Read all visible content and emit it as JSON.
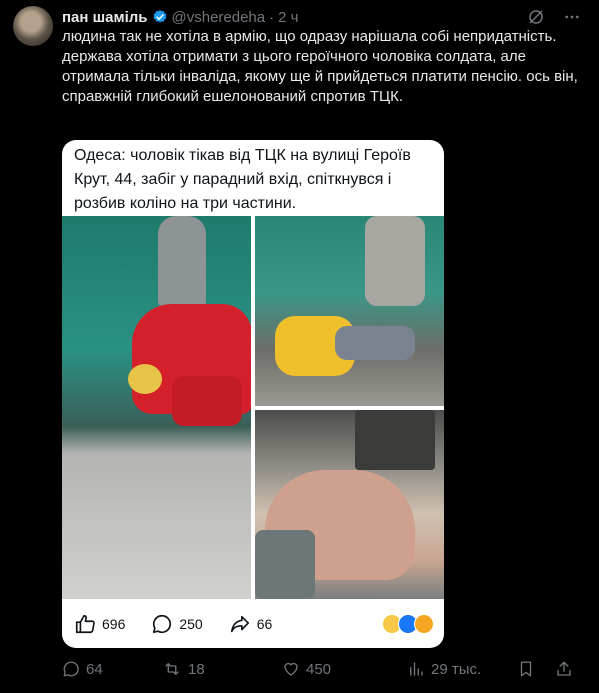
{
  "author": {
    "name": "пан шаміль",
    "handle": "@vsheredeha",
    "separator": "·",
    "time": "2 ч"
  },
  "tweet": {
    "text": "людина так не хотіла в армію, що одразу нарішала собі непридатність. держава хотіла отримати з цього героїчного чоловіка солдата, але отримала тільки інваліда, якому ще й прийдеться платити пенсію. ось він, справжній глибокий ешелонований спротив ТЦК."
  },
  "quoted_card": {
    "text": "Одеса: чоловік тікав від ТЦК на вулиці Героїв Крут, 44, забіг у парадний вхід, спіткнувся і розбив коліно на три частини.",
    "likes": "696",
    "comments": "250",
    "shares": "66",
    "reactions": [
      "sad-face",
      "like",
      "wow-face"
    ]
  },
  "actions": {
    "replies": "64",
    "reposts": "18",
    "likes": "450",
    "views": "29 тыс."
  },
  "colors": {
    "background": "#000000",
    "text": "#e7e9ea",
    "muted": "#71767b",
    "verified": "#1d9bf0"
  }
}
